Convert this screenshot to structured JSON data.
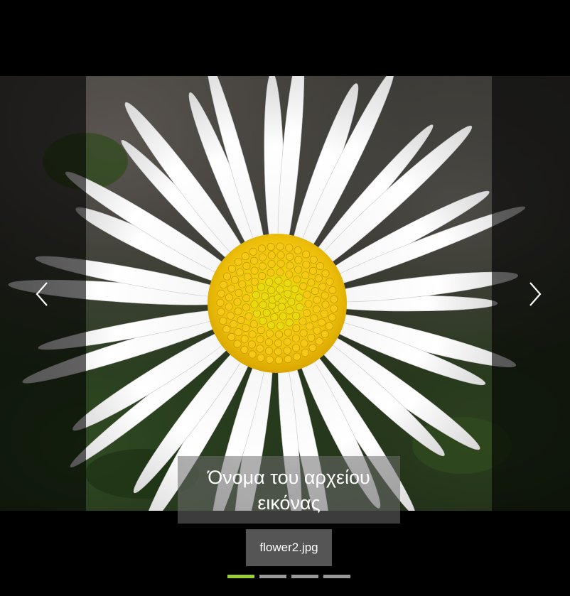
{
  "viewer": {
    "caption": "Όνομα του αρχείου εικόνας",
    "filename": "flower2.jpg",
    "pager": {
      "total": 4,
      "active": 1
    }
  },
  "icons": {
    "previous": "chevron-left-icon",
    "next": "chevron-right-icon"
  },
  "colors": {
    "background": "#000000",
    "pager_active": "#9acd32",
    "pager_inactive": "#9a9a9a",
    "filename_bg": "#555555"
  }
}
